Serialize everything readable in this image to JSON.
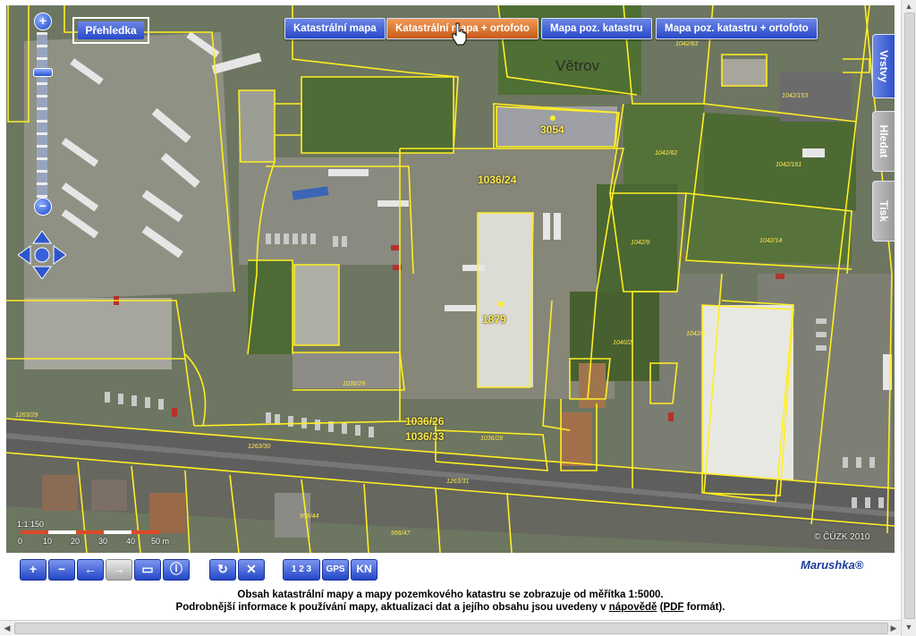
{
  "map": {
    "tabs": [
      {
        "label": "Katastrální mapa",
        "active": false
      },
      {
        "label": "Katastrální mapa + ortofoto",
        "active": true
      },
      {
        "label": "Mapa poz. katastru",
        "active": false
      },
      {
        "label": "Mapa poz. katastru + ortofoto",
        "active": false
      }
    ],
    "overview_button": "Přehledka",
    "side_tabs": [
      "Vrstvy",
      "Hledat",
      "Tisk"
    ],
    "place_name": "Větrov",
    "parcel_labels": {
      "p3054": "3054",
      "p1036_24": "1036/24",
      "p1879": "1879",
      "p1036_26": "1036/26",
      "p1036_33": "1036/33"
    },
    "small_labels": {
      "s1": "1042/62",
      "s2": "1042/161",
      "s3": "1042/153",
      "s4": "1042/9",
      "s5": "1042/14",
      "s6": "1040/2",
      "s7": "1042/8",
      "s8": "1036/29",
      "s9": "1263/29",
      "s10": "1036/28",
      "s11": "1263/30",
      "s12": "1263/31",
      "s13": "956/44",
      "s14": "956/47",
      "s15": "1042/63"
    },
    "scale": {
      "ratio": "1:1 150",
      "ticks": [
        "0",
        "10",
        "20",
        "30",
        "40",
        "50 m"
      ]
    },
    "copyright": "© ČÚZK 2010",
    "colors": {
      "parcel_line": "#ffee22",
      "tab_blue": "#2848c8",
      "tab_active": "#c85a18"
    }
  },
  "toolbar": {
    "icons": [
      "zoom-in-icon",
      "zoom-out-icon",
      "back-icon",
      "forward-icon",
      "zoom-extent-icon",
      "info-icon",
      "refresh-icon",
      "clear-icon",
      "parcel-numbers-icon",
      "gps-icon",
      "kn-icon"
    ],
    "numbers_label": "1 2 3",
    "gps_label": "GPS",
    "kn_label": "KN"
  },
  "brand": "Marushka®",
  "notice": {
    "line1": "Obsah katastrální mapy a mapy pozemkového katastru se zobrazuje od měřítka 1:5000.",
    "line2_prefix": "Podrobnější informace k používání mapy, aktualizaci dat a jejího obsahu jsou uvedeny v ",
    "help_link": "nápovědě",
    "line2_mid": " (",
    "pdf_link": "PDF",
    "line2_suffix": " formát)."
  }
}
